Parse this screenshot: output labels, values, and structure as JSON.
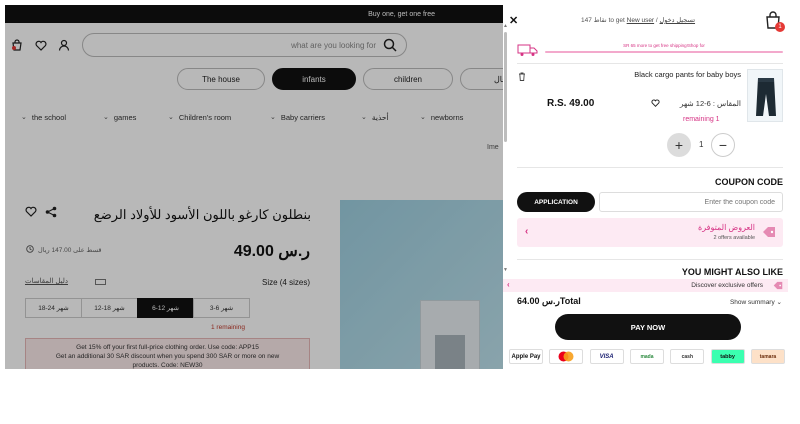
{
  "background_page": {
    "promo_strip": "Buy one, get one free",
    "search": {
      "placeholder": "what are you looking for"
    },
    "category_pills": [
      {
        "label": "The house",
        "active": false
      },
      {
        "label": "infants",
        "active": true
      },
      {
        "label": "children",
        "active": false
      },
      {
        "label": "رجال",
        "active": false
      }
    ],
    "subnav": [
      "the school",
      "games",
      "Children's room",
      "Baby carriers",
      "أحذية",
      "newborns"
    ],
    "breadcrumb": "Ime",
    "product_title": "بنطلون كارغو باللون الأسود للأولاد الرضع",
    "price": "49.00 ر.س",
    "installment_text": "قسط على 147.00 ريال",
    "size_label": "Size (4 sizes)",
    "size_guide": "دليل المقاسات",
    "sizes": [
      {
        "label": "18-24 شهر",
        "selected": false
      },
      {
        "label": "12-18 شهر",
        "selected": false
      },
      {
        "label": "6-12 شهر",
        "selected": true
      },
      {
        "label": "3-6 شهر",
        "selected": false
      }
    ],
    "remaining": "1 remaining",
    "promo_lines": [
      "Get 15% off your first full-price clothing order. Use code: APP15",
      "Get an additional 30 SAR discount when you spend 300 SAR or more on new",
      "products. Code: NEW30"
    ]
  },
  "cart": {
    "close_icon": "close-icon",
    "login_text_prefix": "to get",
    "login_text_points": "147 نقاط",
    "login_link": "تسجيل دخول",
    "new_user_link": "New user",
    "bag_count": "1",
    "shipping_text": "SR 65 more to get free shipping!Shop for",
    "item": {
      "name": "Black cargo pants for baby boys",
      "price": "R.S. 49.00",
      "size": "المقاس : 6-12 شهر",
      "remaining": "remaining 1",
      "qty": "1",
      "minus": "−",
      "plus": "+"
    },
    "coupon": {
      "title": "COUPON CODE",
      "apply_label": "APPLICATION",
      "placeholder": "Enter the coupon code"
    },
    "offers": {
      "title": "العروض المتوفرة",
      "subtitle": "2 offers available"
    },
    "you_might_also_like": "YOU MIGHT ALSO LIKE",
    "exclusive_offers": "Discover exclusive offers",
    "total": "64.00 ر.سTotal",
    "show_summary": "Show summary",
    "pay_now": "PAY NOW",
    "payment_methods": [
      "Apple Pay",
      "Mastercard",
      "VISA",
      "mada",
      "cash",
      "tabby",
      "tamara"
    ]
  },
  "colors": {
    "accent_pink": "#d63384",
    "dark": "#111111",
    "pink_bg": "#fdeaf3"
  }
}
